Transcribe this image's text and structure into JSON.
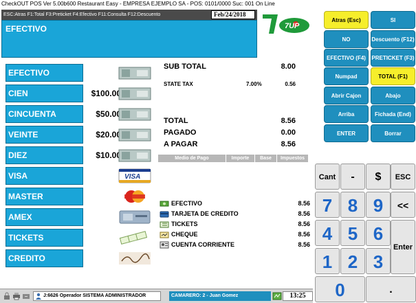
{
  "window": {
    "title": "CheckOUT POS Ver 5.00b600 Restaurant Easy - EMPRESA EJEMPLO SA - POS: 0101/0000 Suc: 001  On Line"
  },
  "keys_hint": "ESC:Atras F1:Total F3:Preticket F4:Efectivo F11:Consulta F12:Descuento",
  "date": "Feb/24/2018",
  "mode": "EFECTIVO",
  "brand_logo": "7UP",
  "function_keys": [
    {
      "label": "Atras (Esc)",
      "color": "#f6ee2b"
    },
    {
      "label": "SI",
      "color": "#1f8fbe"
    },
    {
      "label": "NO",
      "color": "#1f8fbe"
    },
    {
      "label": "Descuento (F12)",
      "color": "#1f8fbe"
    },
    {
      "label": "EFECTIVO (F4)",
      "color": "#1f8fbe"
    },
    {
      "label": "PRETICKET (F3)",
      "color": "#1f8fbe"
    },
    {
      "label": "Numpad",
      "color": "#1f8fbe"
    },
    {
      "label": "TOTAL (F1)",
      "color": "#f6ee2b"
    },
    {
      "label": "Abrir Cajon",
      "color": "#1f8fbe"
    },
    {
      "label": "Abajo",
      "color": "#1f8fbe"
    },
    {
      "label": "Arriba",
      "color": "#1f8fbe"
    },
    {
      "label": "Fichada (End)",
      "color": "#1f8fbe"
    },
    {
      "label": "ENTER",
      "color": "#1f8fbe"
    },
    {
      "label": "Borrar",
      "color": "#1f8fbe"
    }
  ],
  "payments": [
    {
      "label": "EFECTIVO",
      "amount": "",
      "image": "banknote-icon"
    },
    {
      "label": "CIEN",
      "amount": "$100.00",
      "image": "banknote-icon"
    },
    {
      "label": "CINCUENTA",
      "amount": "$50.00",
      "image": "banknote-icon"
    },
    {
      "label": "VEINTE",
      "amount": "$20.00",
      "image": "banknote-icon"
    },
    {
      "label": "DIEZ",
      "amount": "$10.00",
      "image": "banknote-icon"
    },
    {
      "label": "VISA",
      "amount": "",
      "image": "visa-card-icon"
    },
    {
      "label": "MASTER",
      "amount": "",
      "image": "mastercard-icon"
    },
    {
      "label": "AMEX",
      "amount": "",
      "image": "amex-card-icon"
    },
    {
      "label": "TICKETS",
      "amount": "",
      "image": "tickets-icon"
    },
    {
      "label": "CREDITO",
      "amount": "",
      "image": "signature-icon"
    }
  ],
  "totals": {
    "subtotal_label": "SUB TOTAL",
    "subtotal_value": "8.00",
    "tax_label": "STATE TAX",
    "tax_rate": "7.00%",
    "tax_value": "0.56",
    "total_label": "TOTAL",
    "total_value": "8.56",
    "pagado_label": "PAGADO",
    "pagado_value": "0.00",
    "apagar_label": "A PAGAR",
    "apagar_value": "8.56"
  },
  "payment_table": {
    "headers": [
      "Medio de Pago",
      "Importe",
      "Base",
      "Impuestos"
    ]
  },
  "paid_methods": [
    {
      "label": "EFECTIVO",
      "value": "8.56",
      "icon": "cash-icon"
    },
    {
      "label": "TARJETA DE CREDITO",
      "value": "8.56",
      "icon": "credit-card-icon"
    },
    {
      "label": "TICKETS",
      "value": "8.56",
      "icon": "ticket-icon"
    },
    {
      "label": "CHEQUE",
      "value": "8.56",
      "icon": "check-icon"
    },
    {
      "label": "CUENTA CORRIENTE",
      "value": "8.56",
      "icon": "account-icon"
    }
  ],
  "numpad": {
    "cant": "Cant",
    "minus": "-",
    "dollar": "$",
    "esc": "ESC",
    "backspace": "<<",
    "enter": "Enter",
    "dot": ".",
    "digits": [
      "7",
      "8",
      "9",
      "4",
      "5",
      "6",
      "1",
      "2",
      "3",
      "0"
    ]
  },
  "status": {
    "operator": "J:6626 Operador  SISTEMA ADMINISTRADOR",
    "camarero": "CAMARERO: 2 -  Juan Gomez",
    "time": "13:25"
  },
  "colors": {
    "accent": "#1aa5d8",
    "highlight": "#f6ee2b",
    "digit": "#1e66c7",
    "panel_dark": "#4a4a4a"
  }
}
